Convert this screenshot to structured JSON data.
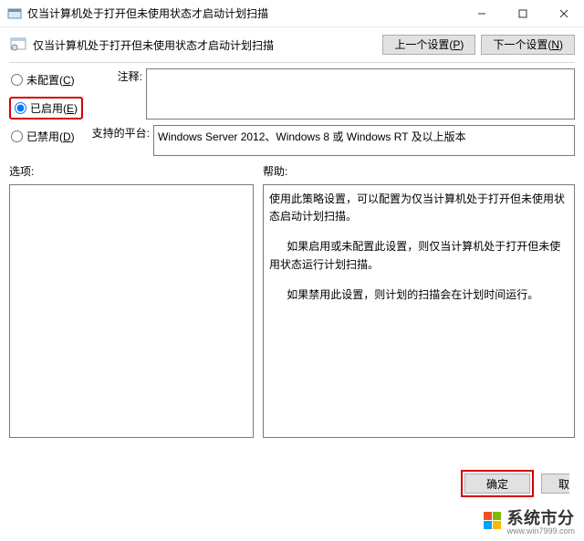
{
  "window": {
    "title": "仅当计算机处于打开但未使用状态才启动计划扫描",
    "subtitle": "仅当计算机处于打开但未使用状态才启动计划扫描"
  },
  "nav": {
    "prev_label": "上一个设置(",
    "prev_key": "P",
    "prev_suffix": ")",
    "next_label": "下一个设置(",
    "next_key": "N",
    "next_suffix": ")"
  },
  "radios": {
    "not_configured": "未配置(",
    "not_configured_key": "C",
    "not_configured_suffix": ")",
    "enabled": "已启用(",
    "enabled_key": "E",
    "enabled_suffix": ")",
    "disabled": "已禁用(",
    "disabled_key": "D",
    "disabled_suffix": ")",
    "selected": "enabled"
  },
  "labels": {
    "comment": "注释:",
    "platform": "支持的平台:",
    "options": "选项:",
    "help": "帮助:"
  },
  "platform_text": "Windows Server 2012、Windows 8 或 Windows RT 及以上版本",
  "help_paragraphs": [
    "使用此策略设置，可以配置为仅当计算机处于打开但未使用状态启动计划扫描。",
    "如果启用或未配置此设置，则仅当计算机处于打开但未使用状态运行计划扫描。",
    "如果禁用此设置，则计划的扫描会在计划时间运行。"
  ],
  "footer": {
    "ok": "确定",
    "cancel_partial": "取"
  },
  "watermark": {
    "text": "系统市分",
    "site": "www.win7999.com"
  }
}
